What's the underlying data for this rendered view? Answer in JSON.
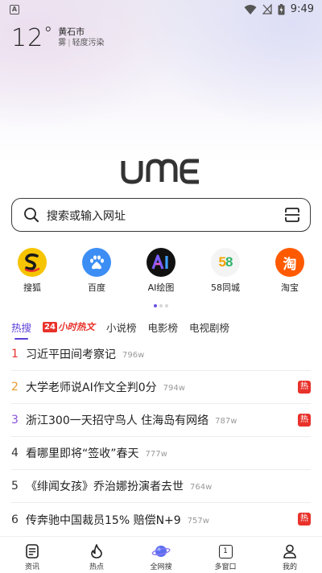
{
  "status_bar": {
    "time": "9:49"
  },
  "weather": {
    "temperature": "12",
    "degree_symbol": "°",
    "city": "黄石市",
    "condition": "雾",
    "air_quality": "轻度污染",
    "separator": "|"
  },
  "logo": {
    "text": "UME"
  },
  "search": {
    "placeholder": "搜索或输入网址"
  },
  "shortcuts": [
    {
      "label": "搜狐",
      "icon": "sohu-icon"
    },
    {
      "label": "百度",
      "icon": "baidu-icon"
    },
    {
      "label": "AI绘图",
      "icon": "ai-drawing-icon"
    },
    {
      "label": "58同城",
      "icon": "58-icon"
    },
    {
      "label": "淘宝",
      "icon": "taobao-icon"
    }
  ],
  "pager": {
    "pages": 3,
    "active": 1
  },
  "hot_tabs": {
    "active": "热搜",
    "tab_24_box": "24",
    "tab_24_text": "小时热文",
    "others": [
      "小说榜",
      "电影榜",
      "电视剧榜"
    ]
  },
  "hot_list": [
    {
      "rank": "1",
      "title": "习近平田间考察记",
      "count": "796w",
      "hot": false
    },
    {
      "rank": "2",
      "title": "大学老师说AI作文全判0分",
      "count": "794w",
      "hot": true
    },
    {
      "rank": "3",
      "title": "浙江300一天招守鸟人 住海岛有网络",
      "count": "787w",
      "hot": true
    },
    {
      "rank": "4",
      "title": "看哪里即将“签收”春天",
      "count": "777w",
      "hot": false
    },
    {
      "rank": "5",
      "title": "《绯闻女孩》乔治娜扮演者去世",
      "count": "764w",
      "hot": false
    },
    {
      "rank": "6",
      "title": "传奔驰中国裁员15% 赔偿N+9",
      "count": "757w",
      "hot": true
    }
  ],
  "hot_badge_label": "热",
  "bottom_nav": [
    {
      "label": "资讯",
      "icon": "news-icon"
    },
    {
      "label": "热点",
      "icon": "flame-icon"
    },
    {
      "label": "全网搜",
      "icon": "planet-icon"
    },
    {
      "label": "多窗口",
      "icon": "window-count-icon",
      "count": "1"
    },
    {
      "label": "我的",
      "icon": "profile-icon"
    }
  ],
  "colors": {
    "accent": "#5b3fd6",
    "hot_red": "#e8322b",
    "rank2": "#e79a2b",
    "rank3": "#8a4fd8"
  }
}
